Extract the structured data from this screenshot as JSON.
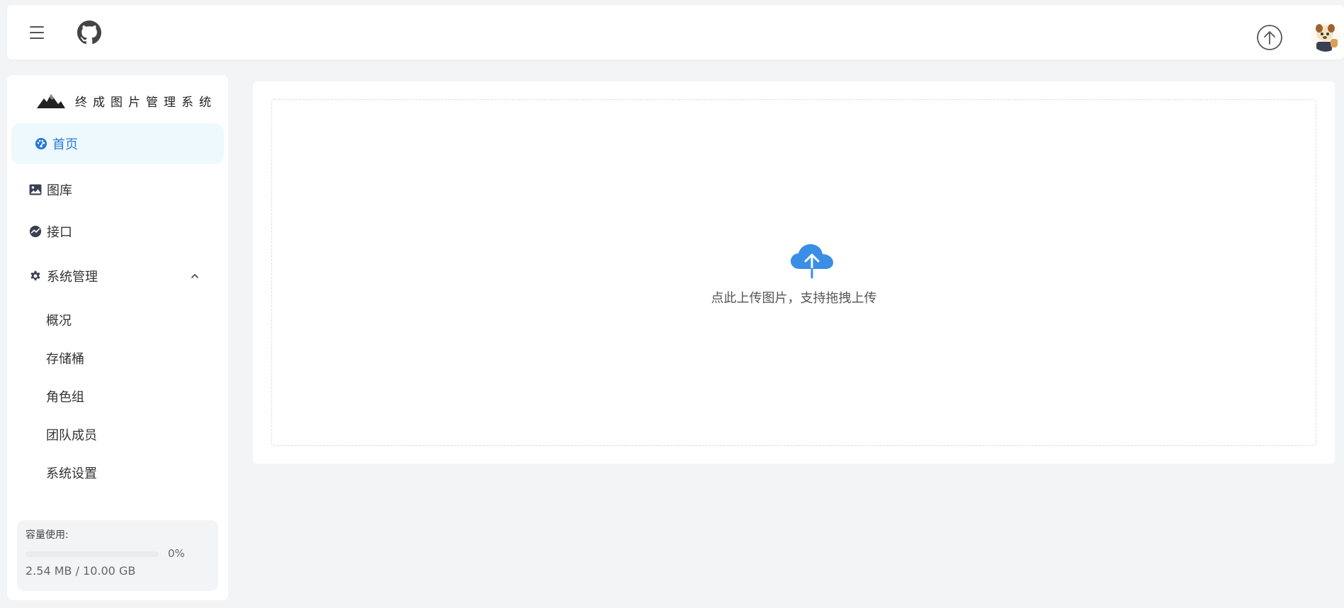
{
  "header": {
    "menu_icon": "hamburger-icon",
    "github_icon": "github-icon",
    "upload_icon": "arrow-up-circle-icon",
    "avatar_icon": "user-avatar"
  },
  "sidebar": {
    "brand_title": "终成图片管理系统",
    "items": [
      {
        "label": "首页",
        "icon": "dashboard-icon"
      },
      {
        "label": "图库",
        "icon": "image-icon"
      },
      {
        "label": "接口",
        "icon": "api-icon"
      },
      {
        "label": "系统管理",
        "icon": "gear-icon"
      }
    ],
    "sub_items": [
      {
        "label": "概况"
      },
      {
        "label": "存储桶"
      },
      {
        "label": "角色组"
      },
      {
        "label": "团队成员"
      },
      {
        "label": "系统设置"
      }
    ],
    "capacity": {
      "label": "容量使用:",
      "percent_text": "0%",
      "percent": 0,
      "size_text": "2.54 MB / 10.00 GB"
    }
  },
  "main": {
    "upload_hint": "点此上传图片，支持拖拽上传",
    "upload_icon": "cloud-upload-icon"
  },
  "colors": {
    "accent": "#3a8ee6",
    "active_bg": "#eef9fd",
    "active_text": "#2a7ad6",
    "page_bg": "#f3f4f6"
  }
}
